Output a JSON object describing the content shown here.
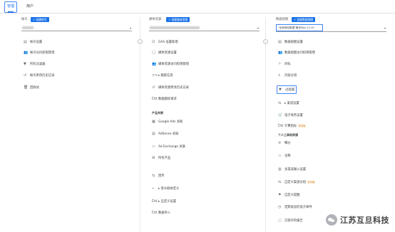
{
  "tabs": {
    "admin": "管理",
    "user": "用户"
  },
  "account": {
    "header": "帐号",
    "create": "+ 创建帐号",
    "items": [
      {
        "icon": "▤",
        "label": "帐号设置"
      },
      {
        "icon": "👥",
        "label": "帐号访问权限管理"
      },
      {
        "icon": "▼",
        "label": "所有过滤器"
      },
      {
        "icon": "↺",
        "label": "帐号更改历史记录"
      },
      {
        "icon": "🗑",
        "label": "回收站"
      }
    ]
  },
  "property": {
    "header": "媒体资源",
    "create": "+ 创建媒体资源",
    "items": [
      {
        "icon": "☑",
        "label": "GA4 设置助理"
      },
      {
        "icon": "▢",
        "label": "媒体资源设置"
      },
      {
        "icon": "👥",
        "label": "媒体资源访问权限管理"
      },
      {
        "icon": "<>",
        "label": "▸ 跟踪信息"
      },
      {
        "icon": "↺",
        "label": "媒体资源更改历史记录"
      },
      {
        "icon": "Dd",
        "label": "数据删除请求"
      }
    ],
    "section_product": "产品关联",
    "product_items": [
      {
        "icon": "▦",
        "label": "Google Ads 关联"
      },
      {
        "icon": "▤",
        "label": "AdSense 关联"
      },
      {
        "icon": "▭",
        "label": "Ad Exchange 关联"
      },
      {
        "icon": "⊞",
        "label": "所有产品"
      }
    ],
    "more_items": [
      {
        "icon": "⇆",
        "label": "回传"
      },
      {
        "icon": "⑂",
        "label": "▸ 受众群体定义"
      },
      {
        "icon": "Dd",
        "label": "▸ 自定义设置"
      },
      {
        "icon": "Dd",
        "label": "数据导入"
      }
    ]
  },
  "view": {
    "header": "数据视图",
    "create": "+ 创建数据视图",
    "selected": "\"全部网站数据\"备份Nov-12-20",
    "items": [
      {
        "icon": "▤",
        "label": "数据视图设置"
      },
      {
        "icon": "👥",
        "label": "数据视图访问权限管理"
      },
      {
        "icon": "⚐",
        "label": "目标"
      },
      {
        "icon": "⅄",
        "label": "内容分组"
      },
      {
        "icon": "▼",
        "label": "过滤器"
      },
      {
        "icon": "⇆",
        "label": "▸ 渠道设置"
      },
      {
        "icon": "🛒",
        "label": "电子商务设置"
      },
      {
        "icon": "Dd",
        "label": "计算指标",
        "tag": "测试版"
      }
    ],
    "section_personal": "个人工具和资源",
    "personal_items": [
      {
        "icon": "≡",
        "label": "细分"
      },
      {
        "icon": "▭",
        "label": "注释"
      },
      {
        "icon": "▥",
        "label": "多渠道漏斗设置"
      },
      {
        "icon": "⇆",
        "label": "自定义渠道分组",
        "tag": "测试版"
      },
      {
        "icon": "⚑",
        "label": "自定义提醒"
      },
      {
        "icon": "◷",
        "label": "定期发送的电子邮件"
      },
      {
        "icon": "▢",
        "label": "已保存的报告"
      }
    ]
  },
  "watermark": {
    "text": "江苏互旦科技"
  }
}
